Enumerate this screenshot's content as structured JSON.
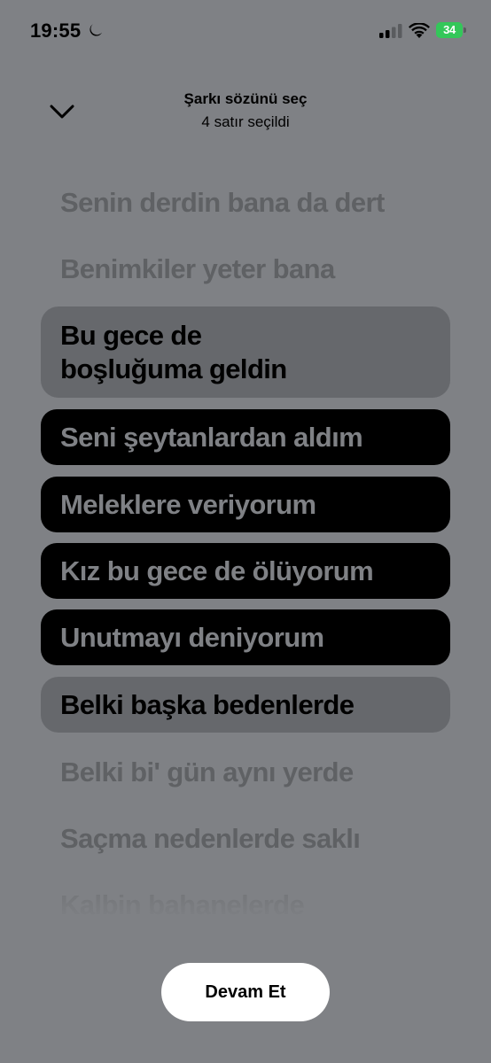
{
  "status_bar": {
    "time": "19:55",
    "battery_level": "34",
    "icons": [
      "moon-icon",
      "cellular-signal-icon",
      "wifi-icon",
      "battery-charging-icon"
    ]
  },
  "header": {
    "title": "Şarkı sözünü seç",
    "subtitle": "4 satır seçildi",
    "collapse_icon": "chevron-down-icon"
  },
  "lyrics": [
    {
      "text": "Senin derdin bana da dert",
      "state": "unselected"
    },
    {
      "text": "Benimkiler yeter bana",
      "state": "unselected"
    },
    {
      "text": "Bu gece de\nboşluğuma geldin",
      "state": "adjacent"
    },
    {
      "text": "Seni şeytanlardan aldım",
      "state": "selected"
    },
    {
      "text": "Meleklere veriyorum",
      "state": "selected"
    },
    {
      "text": "Kız bu gece de ölüyorum",
      "state": "selected"
    },
    {
      "text": "Unutmayı deniyorum",
      "state": "selected"
    },
    {
      "text": "Belki başka bedenlerde",
      "state": "adjacent"
    },
    {
      "text": "Belki bi' gün aynı yerde",
      "state": "unselected"
    },
    {
      "text": "Saçma nedenlerde saklı",
      "state": "unselected"
    },
    {
      "text": "Kalbin bahanelerde",
      "state": "unselected"
    }
  ],
  "continue_button": {
    "label": "Devam Et"
  },
  "colors": {
    "background": "#7f8185",
    "selected_row": "#000000",
    "adjacent_row": "#66686c",
    "unselected_text": "#5f6164",
    "battery": "#33c759",
    "button": "#ffffff"
  }
}
